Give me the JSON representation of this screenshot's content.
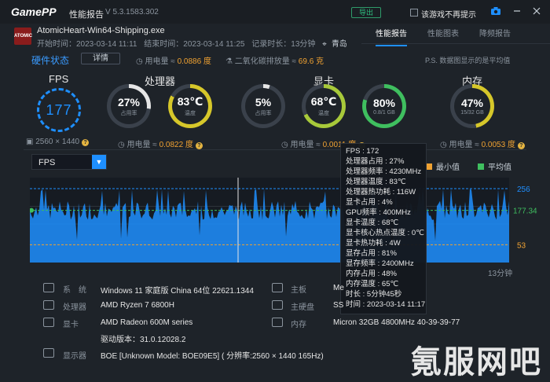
{
  "app": {
    "logo": "GamePP",
    "title": "性能报告",
    "version": "V 5.3.1583.302",
    "export_label": "导出",
    "no_show_label": "该游戏不再提示"
  },
  "process": {
    "icon_text": "ATOMIC",
    "name": "AtomicHeart-Win64-Shipping.exe",
    "start": "开始时间：2023-03-14 11:11",
    "end": "结束时间：2023-03-14 11:25",
    "duration": "记录时长：13分钟",
    "location": "青岛"
  },
  "tabs": [
    "性能报告",
    "性能图表",
    "降频报告"
  ],
  "summary": {
    "hw_status": "硬件状态",
    "detail_btn": "详情",
    "power": "用电量 ≈ ",
    "power_val": "0.0886 度",
    "co2": "二氧化碳排放量 ≈ ",
    "co2_val": "69.6 克",
    "ps_note": "P.S. 数据图显示的是平均值"
  },
  "sections": {
    "fps": "FPS",
    "cpu": "处理器",
    "gpu": "显卡",
    "mem": "内存"
  },
  "gauges": {
    "fps_value": "177",
    "fps_res": "2560 × 1440",
    "cpu_usage": {
      "value": "27%",
      "label": "占用率",
      "percent": 27
    },
    "cpu_temp": {
      "value": "83℃",
      "label": "温度",
      "percent": 83
    },
    "gpu_usage": {
      "value": "5%",
      "label": "占用率",
      "percent": 5
    },
    "gpu_temp": {
      "value": "68℃",
      "label": "温度",
      "percent": 68
    },
    "vram": {
      "value": "80%",
      "label": "0.8/1 GB",
      "percent": 80
    },
    "mem": {
      "value": "47%",
      "label": "15/32 GB",
      "percent": 47
    }
  },
  "power": {
    "cpu_label": "用电量 ≈ ",
    "cpu_val": "0.0822 度",
    "gpu_label": "用电量 ≈ ",
    "gpu_val": "0.0011 度",
    "mem_label": "用电量 ≈ ",
    "mem_val": "0.0053 度"
  },
  "chart": {
    "select_label": "FPS",
    "legend_min": "最小值",
    "legend_avg": "平均值",
    "time_label": "13分钟",
    "colors": {
      "line": "#1e8fff",
      "min": "#f0a232",
      "avg": "#3fbf5f"
    }
  },
  "chart_data": {
    "type": "area",
    "y_ticks": [
      "256",
      "177.34",
      "53"
    ],
    "max": 256,
    "avg": 177.34,
    "min": 53,
    "xlabel": "13分钟"
  },
  "tooltip": [
    "FPS : 172",
    "处理器占用 : 27%",
    "处理器频率 : 4230MHz",
    "处理器温度 : 83℃",
    "处理器热功耗 : 116W",
    "显卡占用 : 4%",
    "GPU频率 : 400MHz",
    "显卡温度 : 68℃",
    "显卡核心热点温度 : 0℃",
    "显卡热功耗 : 4W",
    "显存占用 : 81%",
    "显存频率 : 2400MHz",
    "内存占用 : 48%",
    "内存温度 : 65℃",
    "时长 : 5分钟45秒",
    "时间 : 2023-03-14 11:17"
  ],
  "specs": {
    "os_label": "系　统",
    "os_val": "Windows 11 家庭版 China 64位 22621.1344",
    "cpu_label": "处理器",
    "cpu_val": "AMD Ryzen 7 6800H",
    "gpu_label": "显卡",
    "gpu_val": "AMD Radeon 600M series",
    "driver_val": "驱动版本：31.0.12028.2",
    "display_label": "显示器",
    "display_val": "BOE [Unknown Model: BOE09E5] ( 分辨率:2560 × 1440 165Hz)",
    "board_label": "主板",
    "board_val": "Me",
    "disk_label": "主硬盘",
    "disk_val": "SS",
    "mem_label": "内存",
    "mem_val": "Micron 32GB 4800MHz 40-39-39-77"
  },
  "watermark": "氪服网吧"
}
